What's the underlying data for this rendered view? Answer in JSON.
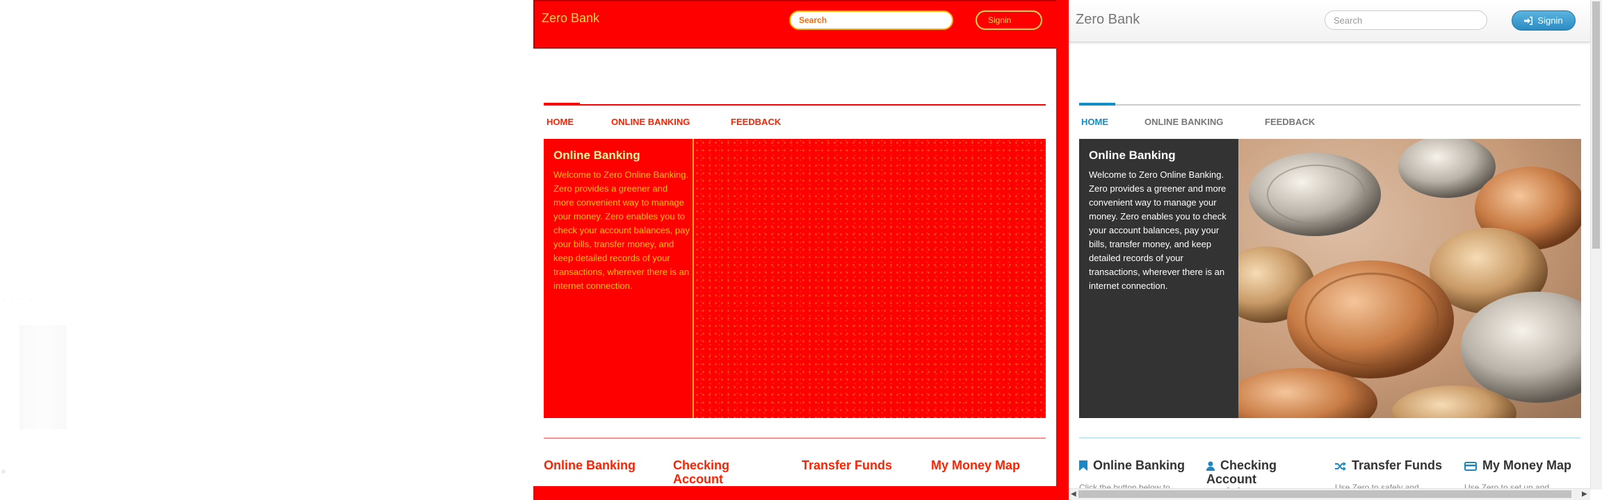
{
  "site": {
    "brand": "Zero Bank",
    "search": {
      "placeholder": "Search"
    },
    "signin_label": "Signin"
  },
  "nav": {
    "items": [
      {
        "label": "HOME",
        "active": true
      },
      {
        "label": "ONLINE BANKING",
        "active": false
      },
      {
        "label": "FEEDBACK",
        "active": false
      }
    ]
  },
  "hero": {
    "title": "Online Banking",
    "text": "Welcome to Zero Online Banking. Zero provides a greener and more convenient way to manage your money. Zero enables you to check your account balances, pay your bills, transfer money, and keep detailed records of your transactions, wherever there is an internet connection."
  },
  "features": [
    {
      "title": "Online Banking",
      "icon": "bookmark-icon",
      "text": "Click the button below to"
    },
    {
      "title": "Checking Account Activity",
      "icon": "user-icon",
      "text": ""
    },
    {
      "title": "Transfer Funds",
      "icon": "shuffle-icon",
      "text": "Use Zero to safely and"
    },
    {
      "title": "My Money Map",
      "icon": "credit-card-icon",
      "text": "Use Zero to set up and"
    }
  ],
  "diff_overlay": {
    "brand": "Zero Bank",
    "search_placeholder": "Search",
    "signin_label": "Signin"
  },
  "colors": {
    "accent": "#0d8fc7",
    "diff_red": "#ff0000",
    "hero_dark": "#333333",
    "signin_blue": "#2b8cc4"
  }
}
